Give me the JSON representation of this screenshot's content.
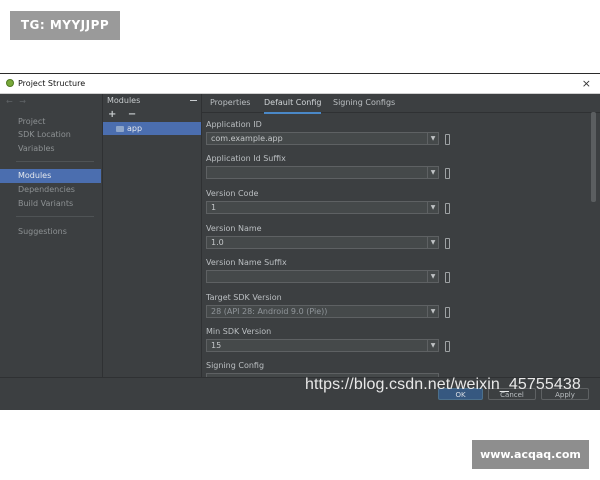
{
  "overlay": {
    "top_tag": "TG: MYYJJPP",
    "bottom_tag": "www.acqaq.com",
    "url_watermark": "https://blog.csdn.net/weixin_45755438"
  },
  "window": {
    "title": "Project Structure",
    "close_glyph": "×"
  },
  "nav": {
    "back_glyph": "←",
    "forward_glyph": "→",
    "items": [
      {
        "label": "Project"
      },
      {
        "label": "SDK Location"
      },
      {
        "label": "Variables"
      },
      {
        "label": "Modules",
        "active": true
      },
      {
        "label": "Dependencies"
      },
      {
        "label": "Build Variants"
      },
      {
        "label": "Suggestions"
      }
    ]
  },
  "modules": {
    "header": "Modules",
    "add_glyph": "+",
    "remove_glyph": "−",
    "items": [
      {
        "label": "app"
      }
    ]
  },
  "tabs": [
    {
      "label": "Properties"
    },
    {
      "label": "Default Config",
      "active": true
    },
    {
      "label": "Signing Configs"
    }
  ],
  "fields": [
    {
      "label": "Application ID",
      "value": "com.example.app"
    },
    {
      "label": "Application Id Suffix",
      "value": ""
    },
    {
      "label": "Version Code",
      "value": "1"
    },
    {
      "label": "Version Name",
      "value": "1.0"
    },
    {
      "label": "Version Name Suffix",
      "value": ""
    },
    {
      "label": "Target SDK Version",
      "value": "28 (API 28: Android 9.0 (Pie))"
    },
    {
      "label": "Min SDK Version",
      "value": "15"
    },
    {
      "label": "Signing Config",
      "value": ""
    }
  ],
  "buttons": {
    "ok": "OK",
    "cancel": "Cancel",
    "apply": "Apply"
  },
  "colors": {
    "accent": "#4b6eaf",
    "window_bg": "#3c3f41"
  }
}
